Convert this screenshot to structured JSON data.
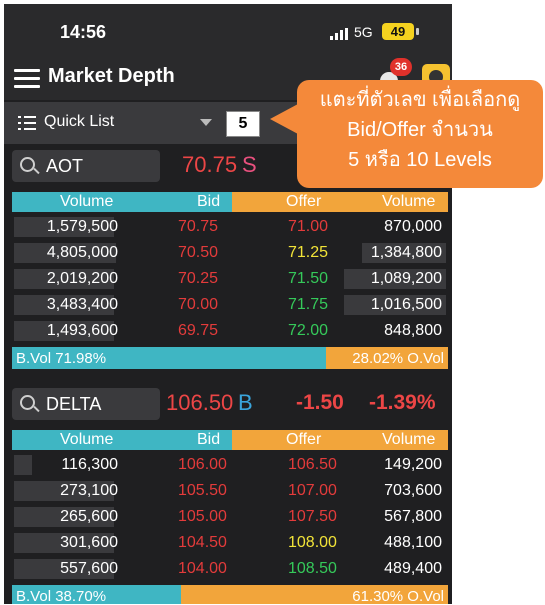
{
  "status_bar": {
    "time": "14:56",
    "network": "5G",
    "battery": "49"
  },
  "header": {
    "title": "Market Depth",
    "notification_count": "36"
  },
  "quick_list": {
    "label": "Quick List",
    "levels": "5"
  },
  "columns": {
    "volume": "Volume",
    "bid": "Bid",
    "offer": "Offer",
    "volume2": "Volume"
  },
  "callout": {
    "line1": "แตะที่ตัวเลข เพื่อเลือกดู",
    "line2": "Bid/Offer จำนวน",
    "line3": "5 หรือ 10  Levels"
  },
  "stocks": [
    {
      "symbol": "AOT",
      "last": "70.75",
      "flag": "S",
      "flag_color": "#e8507e",
      "change": "",
      "pct_change": "",
      "rows": [
        {
          "bid_volume": "1,579,500",
          "bid": "70.75",
          "offer": "71.00",
          "offer_volume": "870,000"
        },
        {
          "bid_volume": "4,805,000",
          "bid": "70.50",
          "offer": "71.25",
          "offer_volume": "1,384,800"
        },
        {
          "bid_volume": "2,019,200",
          "bid": "70.25",
          "offer": "71.50",
          "offer_volume": "1,089,200"
        },
        {
          "bid_volume": "3,483,400",
          "bid": "70.00",
          "offer": "71.75",
          "offer_volume": "1,016,500"
        },
        {
          "bid_volume": "1,493,600",
          "bid": "69.75",
          "offer": "72.00",
          "offer_volume": "848,800"
        }
      ],
      "bid_vol_label": "B.Vol 71.98%",
      "offer_vol_label": "28.02% O.Vol",
      "bid_vol_pct": 71.98
    },
    {
      "symbol": "DELTA",
      "last": "106.50",
      "flag": "B",
      "flag_color": "#3aa5dc",
      "change": "-1.50",
      "pct_change": "-1.39%",
      "rows": [
        {
          "bid_volume": "116,300",
          "bid": "106.00",
          "offer": "106.50",
          "offer_volume": "149,200"
        },
        {
          "bid_volume": "273,100",
          "bid": "105.50",
          "offer": "107.00",
          "offer_volume": "703,600"
        },
        {
          "bid_volume": "265,600",
          "bid": "105.00",
          "offer": "107.50",
          "offer_volume": "567,800"
        },
        {
          "bid_volume": "301,600",
          "bid": "104.50",
          "offer": "108.00",
          "offer_volume": "488,100"
        },
        {
          "bid_volume": "557,600",
          "bid": "104.00",
          "offer": "108.50",
          "offer_volume": "489,400"
        }
      ],
      "bid_vol_label": "B.Vol 38.70%",
      "offer_vol_label": "61.30% O.Vol",
      "bid_vol_pct": 38.7
    }
  ],
  "colors": {
    "bid": "#e33b3b",
    "offer_up": "#f1e338",
    "offer_green": "#35c95a",
    "offer_red": "#e33b3b"
  }
}
